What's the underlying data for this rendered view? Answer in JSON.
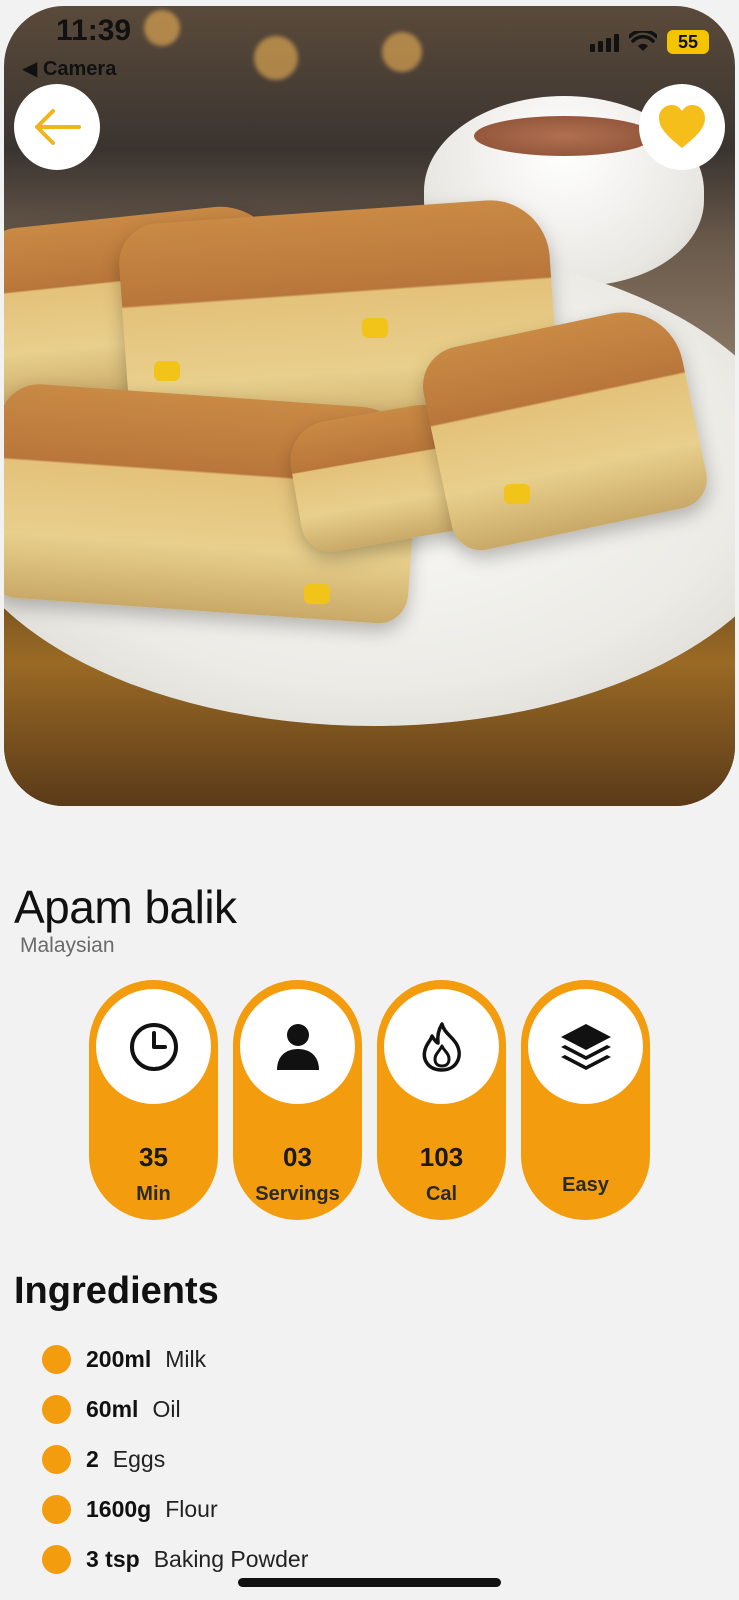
{
  "status_bar": {
    "time": "11:39",
    "back_app": "Camera",
    "battery": "55"
  },
  "hero": {
    "image_icon": "apam-balik-photo",
    "back_icon": "arrow-left-icon",
    "favorite_icon": "heart-icon",
    "accent_color": "#f5be1a"
  },
  "recipe": {
    "title": "Apam balik",
    "cuisine": "Malaysian"
  },
  "stats": [
    {
      "icon": "clock-icon",
      "value": "35",
      "unit": "Min"
    },
    {
      "icon": "person-icon",
      "value": "03",
      "unit": "Servings"
    },
    {
      "icon": "flame-icon",
      "value": "103",
      "unit": "Cal"
    },
    {
      "icon": "layers-icon",
      "label": "Easy"
    }
  ],
  "ingredients": {
    "heading": "Ingredients",
    "items": [
      {
        "qty": "200ml",
        "name": "Milk"
      },
      {
        "qty": "60ml",
        "name": "Oil"
      },
      {
        "qty": "2",
        "name": "Eggs"
      },
      {
        "qty": "1600g",
        "name": "Flour"
      },
      {
        "qty": "3 tsp",
        "name": "Baking Powder"
      }
    ]
  },
  "colors": {
    "accent": "#f29c0e",
    "background": "#f2f2f2"
  }
}
